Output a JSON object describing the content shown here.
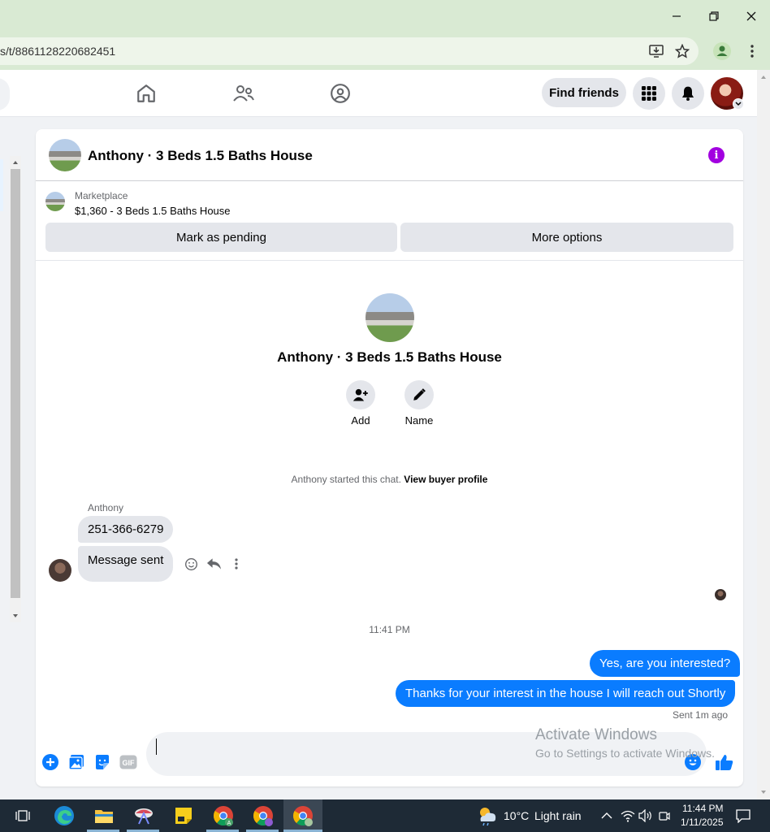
{
  "browser": {
    "url": "s/t/8861128220682451"
  },
  "nav": {
    "find_friends": "Find friends"
  },
  "chat": {
    "title": "Anthony · 3 Beds 1.5 Baths House",
    "marketplace_label": "Marketplace",
    "listing": "$1,360 - 3 Beds 1.5 Baths House",
    "mark_pending": "Mark as pending",
    "more_options": "More options",
    "center_title": "Anthony · 3 Beds 1.5 Baths House",
    "add_label": "Add",
    "name_label": "Name",
    "started_text": "Anthony started this chat.",
    "view_profile": "View buyer profile",
    "sender_name": "Anthony",
    "messages_in": [
      "251-366-6279",
      "Message sent"
    ],
    "timestamp": "11:41 PM",
    "messages_out": [
      "Yes, are you interested?",
      "Thanks for your interest in the house I will reach out Shortly"
    ],
    "sent_status": "Sent 1m ago",
    "gif_label": "GIF"
  },
  "watermark": {
    "line1": "Activate Windows",
    "line2": "Go to Settings to activate Windows."
  },
  "taskbar": {
    "temperature": "10°C",
    "weather": "Light rain",
    "time": "11:44 PM",
    "date": "1/11/2025"
  },
  "colors": {
    "messenger_blue": "#0a7cff",
    "info_purple": "#a200e0",
    "chrome_green": "#d9ead3"
  }
}
